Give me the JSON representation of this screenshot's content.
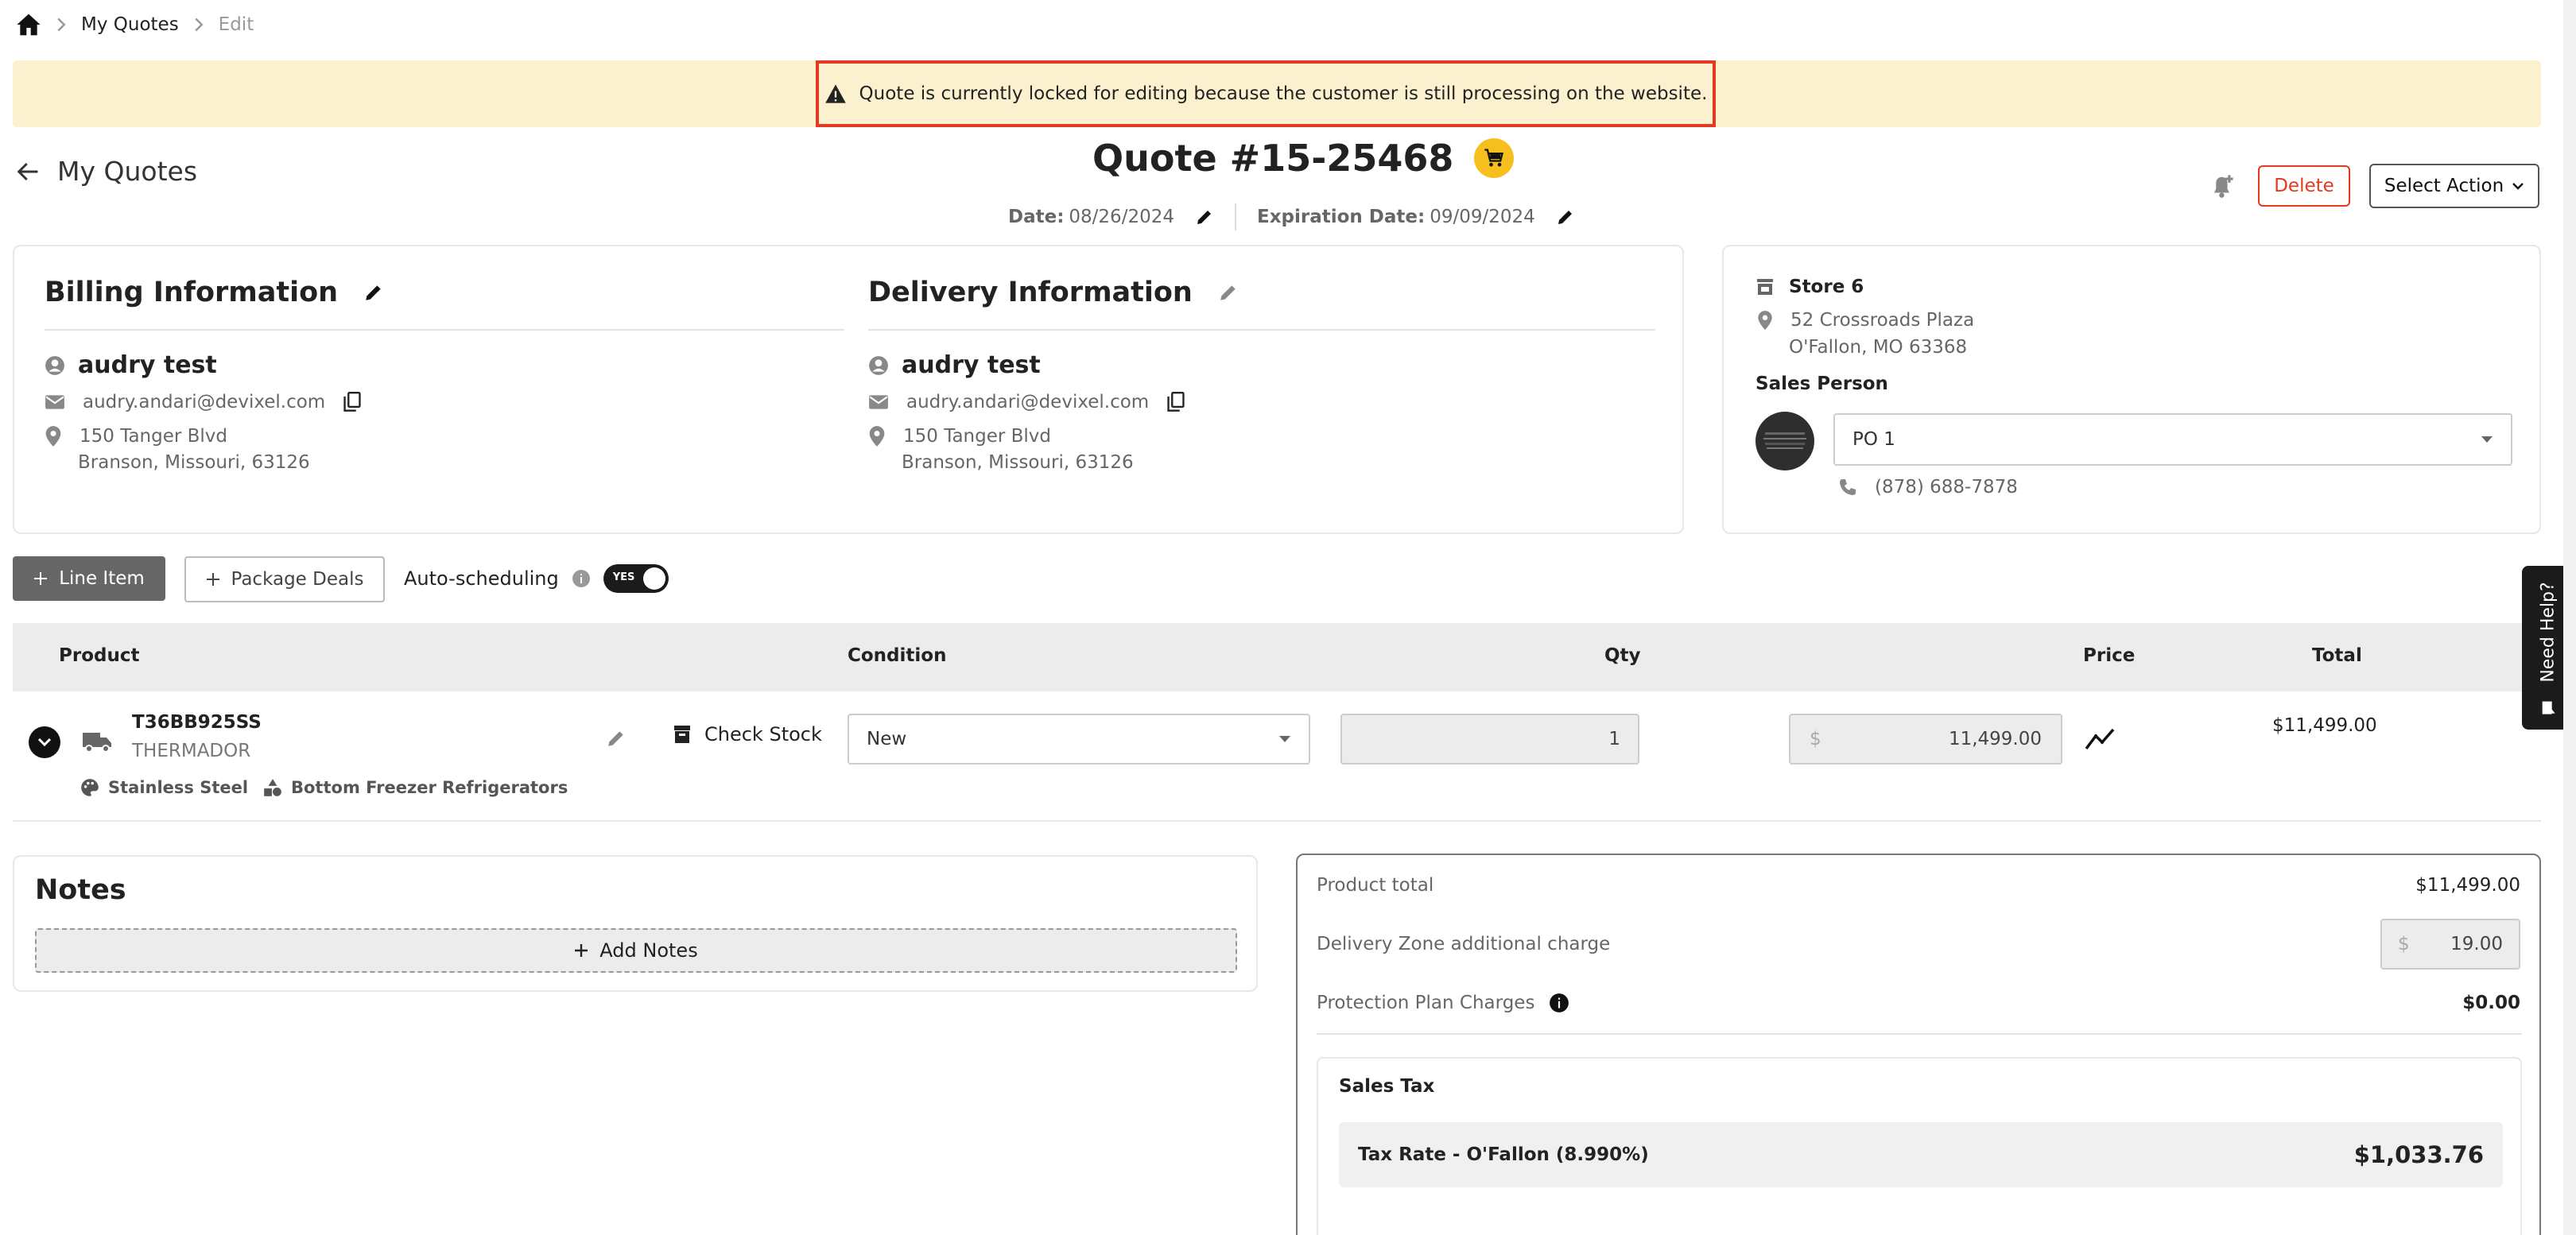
{
  "breadcrumb": {
    "home_icon": "home-icon",
    "item1": "My Quotes",
    "item2": "Edit"
  },
  "banner": {
    "icon": "warning-icon",
    "message": "Quote is currently locked for editing because the customer is still processing on the website."
  },
  "header": {
    "back_label": "My Quotes",
    "quote_title": "Quote #15-25468",
    "date_label": "Date:",
    "date_value": "08/26/2024",
    "expiration_label": "Expiration Date:",
    "expiration_value": "09/09/2024",
    "delete_label": "Delete",
    "select_action_label": "Select Action"
  },
  "billing": {
    "title": "Billing Information",
    "name": "audry test",
    "email": "audry.andari@devixel.com",
    "address1": "150 Tanger Blvd",
    "address2": "Branson, Missouri, 63126"
  },
  "delivery": {
    "title": "Delivery Information",
    "name": "audry test",
    "email": "audry.andari@devixel.com",
    "address1": "150 Tanger Blvd",
    "address2": "Branson, Missouri, 63126"
  },
  "store": {
    "name": "Store 6",
    "address1": "52 Crossroads Plaza",
    "address2": "O'Fallon, MO 63368",
    "sales_person_label": "Sales Person",
    "sales_person_value": "PO 1",
    "phone": "(878) 688-7878"
  },
  "actions": {
    "line_item": "Line Item",
    "package_deals": "Package Deals",
    "auto_scheduling": "Auto-scheduling",
    "toggle_label": "YES"
  },
  "table": {
    "headers": [
      "Product",
      "Condition",
      "Qty",
      "Price",
      "Total"
    ],
    "row": {
      "sku": "T36BB925SS",
      "brand": "THERMADOR",
      "check_stock": "Check Stock",
      "condition": "New",
      "qty": "1",
      "currency": "$",
      "price": "11,499.00",
      "total": "$11,499.00",
      "tag1": "Stainless Steel",
      "tag2": "Bottom Freezer Refrigerators"
    }
  },
  "notes": {
    "title": "Notes",
    "add_label": "Add Notes"
  },
  "summary": {
    "product_total_label": "Product total",
    "product_total_value": "$11,499.00",
    "delivery_label": "Delivery Zone additional charge",
    "delivery_currency": "$",
    "delivery_value": "19.00",
    "protection_label": "Protection Plan Charges",
    "protection_value": "$0.00",
    "sales_tax_title": "Sales Tax",
    "tax_rate_label": "Tax Rate - O'Fallon (8.990%)",
    "tax_rate_value": "$1,033.76"
  },
  "need_help": "Need Help?",
  "colors": {
    "banner_bg": "#fcf1cf",
    "banner_border": "#e53820",
    "accent_yellow": "#f7bf1e",
    "delete_red": "#e53820"
  }
}
